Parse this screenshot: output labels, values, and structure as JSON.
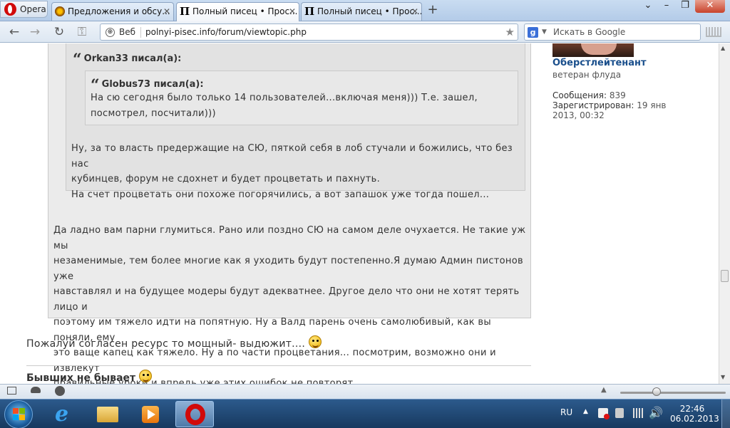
{
  "browser": {
    "menu_label": "Opera",
    "tabs": [
      {
        "label": "Предложения и обсу...",
        "active": false
      },
      {
        "label": "Полный писец • Прос...",
        "active": true
      },
      {
        "label": "Полный писец • Прос...",
        "active": false
      }
    ],
    "new_tab": "+",
    "address": {
      "site_label": "Веб",
      "url": "polnyi-pisec.info/forum/viewtopic.php"
    },
    "search": {
      "placeholder": "Искать в Google"
    }
  },
  "forum": {
    "author": {
      "rank": "Оберстлейтенант",
      "title": "ветеран флуда",
      "posts_label": "Сообщения:",
      "posts_value": "839",
      "registered_label": "Зарегистрирован:",
      "registered_date": "19 янв",
      "registered_rest": "2013, 00:32"
    },
    "quote_outer": {
      "author": "Orkan33 писал(а):",
      "inner": {
        "author": "Globus73 писал(а):",
        "text_lines": [
          "На сю сегодня было только 14 пользователей...включая меня))) Т.е. зашел,",
          "посмотрел, посчитали)))"
        ]
      },
      "text_lines": [
        "Ну, за то власть предержащие на СЮ, пяткой себя в лоб стучали и божились, что без нас",
        "кубинцев, форум не сдохнет и будет процветать и пахнуть.",
        "На счет процветать они похоже погорячились, а вот запашок уже тогда пошел..."
      ]
    },
    "quote_text_lines": [
      "Да ладно вам парни глумиться. Рано или поздно СЮ на самом деле очухается. Не такие уж мы",
      "незаменимые, тем более многие как я уходить будут постепенно.Я думаю Админ пистонов уже",
      "навставлял и на будущее модеры будут адекватнее. Другое дело что они не хотят терять лицо и",
      "поэтому им тяжело идти на попятную. Ну а Валд парень очень самолюбивый, как вы поняли, ему",
      "это ваще капец как тяжело. Ну а по части процветания... посмотрим, возможно они и извлекут",
      "правильные уроки и впредь уже этих ошибок не повторят."
    ],
    "reply_text": "Пожалуй согласен ресурс то мощный- выдюжит....",
    "signature": "Бывших не бывает"
  },
  "taskbar": {
    "language": "RU",
    "time": "22:46",
    "date": "06.02.2013"
  },
  "colors": {
    "accent": "#1a4f8c",
    "quote_bg": "#ebebeb",
    "opera_red": "#d10a0a"
  }
}
